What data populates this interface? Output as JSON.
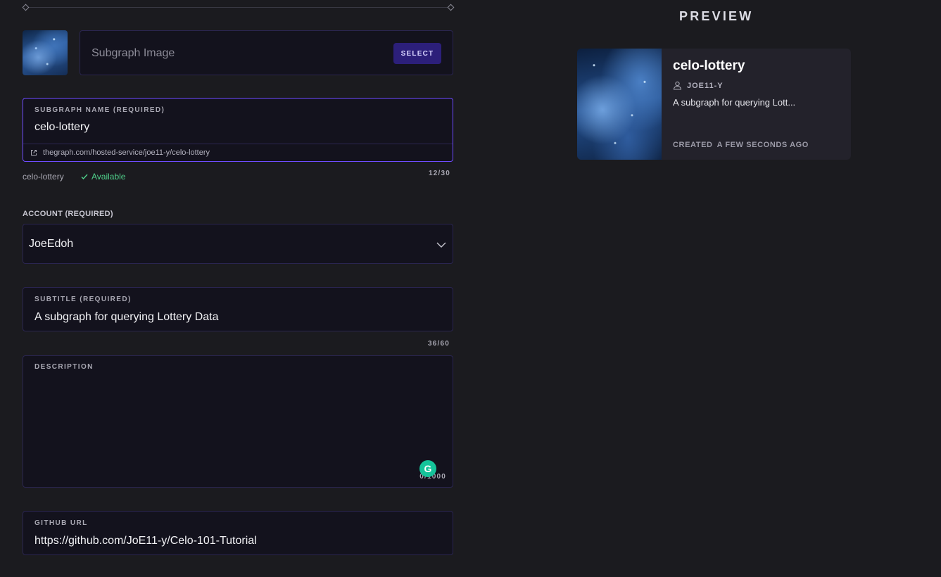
{
  "image_field": {
    "placeholder": "Subgraph Image",
    "select_label": "SELECT"
  },
  "name_field": {
    "label": "SUBGRAPH NAME (REQUIRED)",
    "value": "celo-lottery",
    "url": "thegraph.com/hosted-service/joe11-y/celo-lottery",
    "slug": "celo-lottery",
    "availability": "Available",
    "counter": "12/30"
  },
  "account_field": {
    "label": "ACCOUNT (REQUIRED)",
    "value": "JoeEdoh"
  },
  "subtitle_field": {
    "label": "SUBTITLE (REQUIRED)",
    "value": "A subgraph for querying Lottery Data",
    "counter": "36/60"
  },
  "description_field": {
    "label": "DESCRIPTION",
    "value": "",
    "counter": "0/1000",
    "grammarly_glyph": "G"
  },
  "github_field": {
    "label": "GITHUB URL",
    "value": "https://github.com/JoE11-y/Celo-101-Tutorial"
  },
  "preview": {
    "heading": "PREVIEW",
    "card": {
      "title": "celo-lottery",
      "owner": "JOE11-Y",
      "subtitle": "A subgraph for querying Lott...",
      "created_label": "CREATED",
      "created_when": "A FEW SECONDS AGO"
    }
  },
  "colors": {
    "background": "#1b1b1f",
    "field_bg": "#13121d",
    "accent": "#6f4cff",
    "select_button": "#2c1f7a",
    "available": "#4fd18b",
    "grammarly": "#15c39a"
  },
  "icons": [
    "link-external-icon",
    "check-icon",
    "chevron-down-icon",
    "user-icon",
    "grammarly-icon"
  ]
}
